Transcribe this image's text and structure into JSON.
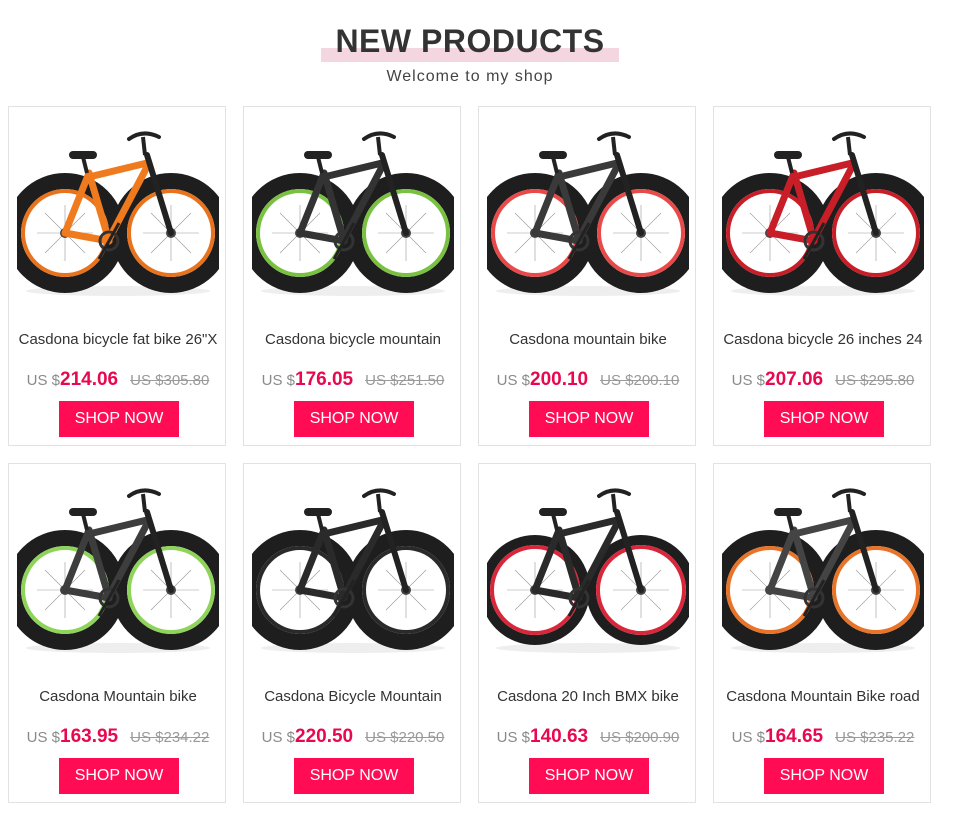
{
  "header": {
    "title": "NEW PRODUCTS",
    "subtitle": "Welcome to my shop"
  },
  "products": [
    {
      "name": "Casdona bicycle fat bike 26\"X",
      "currency": "US $",
      "price": "214.06",
      "old_price": "US $305.80",
      "button": "SHOP NOW",
      "frame_color": "#f07a1e",
      "rim_color": "#e8731c",
      "image_icon": "fat-bike-icon"
    },
    {
      "name": "Casdona bicycle mountain",
      "currency": "US $",
      "price": "176.05",
      "old_price": "US $251.50",
      "button": "SHOP NOW",
      "frame_color": "#333333",
      "rim_color": "#7ac142",
      "image_icon": "fat-bike-icon"
    },
    {
      "name": "Casdona mountain bike",
      "currency": "US $",
      "price": "200.10",
      "old_price": "US $200.10",
      "button": "SHOP NOW",
      "frame_color": "#3a3a3a",
      "rim_color": "#e84a4a",
      "image_icon": "fat-bike-icon"
    },
    {
      "name": "Casdona bicycle 26 inches 24",
      "currency": "US $",
      "price": "207.06",
      "old_price": "US $295.80",
      "button": "SHOP NOW",
      "frame_color": "#c81e28",
      "rim_color": "#c81e28",
      "image_icon": "fat-bike-icon"
    },
    {
      "name": "Casdona Mountain bike",
      "currency": "US $",
      "price": "163.95",
      "old_price": "US $234.22",
      "button": "SHOP NOW",
      "frame_color": "#3d3d3d",
      "rim_color": "#8fd45a",
      "image_icon": "fat-bike-icon"
    },
    {
      "name": "Casdona Bicycle Mountain",
      "currency": "US $",
      "price": "220.50",
      "old_price": "US $220.50",
      "button": "SHOP NOW",
      "frame_color": "#2a2a2a",
      "rim_color": "#2a2a2a",
      "image_icon": "fat-bike-icon"
    },
    {
      "name": "Casdona 20 Inch BMX bike",
      "currency": "US $",
      "price": "140.63",
      "old_price": "US $200.90",
      "button": "SHOP NOW",
      "frame_color": "#2a2a2a",
      "rim_color": "#d8263a",
      "image_icon": "bmx-bike-icon"
    },
    {
      "name": "Casdona Mountain Bike road",
      "currency": "US $",
      "price": "164.65",
      "old_price": "US $235.22",
      "button": "SHOP NOW",
      "frame_color": "#444444",
      "rim_color": "#e8742a",
      "image_icon": "fat-bike-icon"
    }
  ]
}
